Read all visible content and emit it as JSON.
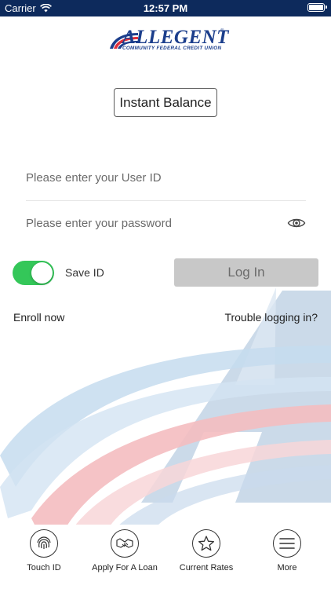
{
  "status_bar": {
    "carrier": "Carrier",
    "time": "12:57 PM"
  },
  "brand": {
    "name": "ALLEGENT",
    "tagline": "COMMUNITY FEDERAL CREDIT UNION",
    "colors": {
      "navy": "#1b3e8c",
      "red": "#e0303c",
      "light_blue": "#a7c6e8"
    }
  },
  "instant_balance": {
    "label": "Instant Balance"
  },
  "login_form": {
    "user_id_placeholder": "Please enter your User ID",
    "password_placeholder": "Please enter your password",
    "show_password_icon": "eye-icon",
    "save_id": {
      "label": "Save ID",
      "on": true
    },
    "login_button": "Log In"
  },
  "links": {
    "enroll": "Enroll now",
    "trouble": "Trouble logging in?"
  },
  "tab_bar": [
    {
      "label": "Touch ID",
      "icon": "fingerprint-icon"
    },
    {
      "label": "Apply For A Loan",
      "icon": "handshake-icon"
    },
    {
      "label": "Current Rates",
      "icon": "star-icon"
    },
    {
      "label": "More",
      "icon": "menu-icon"
    }
  ]
}
